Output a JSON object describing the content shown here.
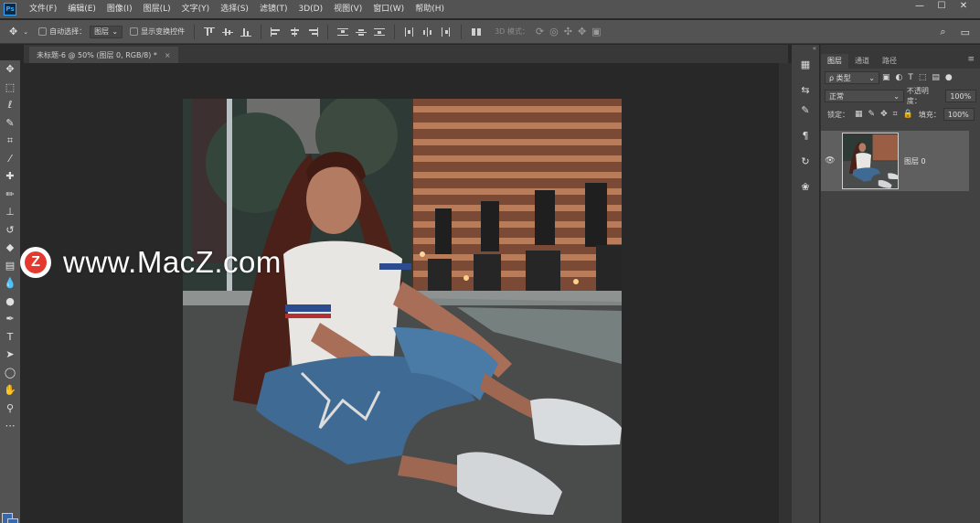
{
  "app": {
    "logo_text": "Ps"
  },
  "menu": [
    "文件(F)",
    "编辑(E)",
    "图像(I)",
    "图层(L)",
    "文字(Y)",
    "选择(S)",
    "滤镜(T)",
    "3D(D)",
    "视图(V)",
    "窗口(W)",
    "帮助(H)"
  ],
  "window_controls": {
    "minimize": "—",
    "maximize": "☐",
    "close": "✕"
  },
  "options": {
    "auto_select_label": "自动选择：",
    "auto_select_value": "图层",
    "show_transform_label": "显示变换控件",
    "mode_3d_label": "3D 模式："
  },
  "document_tab": {
    "title": "未标题-6 @ 50% (图层 0, RGB/8) *",
    "close": "×"
  },
  "watermark": {
    "logo_letter": "Z",
    "text": "www.MacZ.com"
  },
  "layers_panel": {
    "tabs": [
      "图层",
      "通道",
      "路径"
    ],
    "filter_label": "ρ 类型",
    "blend_mode": "正常",
    "opacity_label": "不透明度：",
    "opacity_value": "100%",
    "lock_label": "锁定：",
    "fill_label": "填充：",
    "fill_value": "100%",
    "layer_name": "图层 0"
  }
}
